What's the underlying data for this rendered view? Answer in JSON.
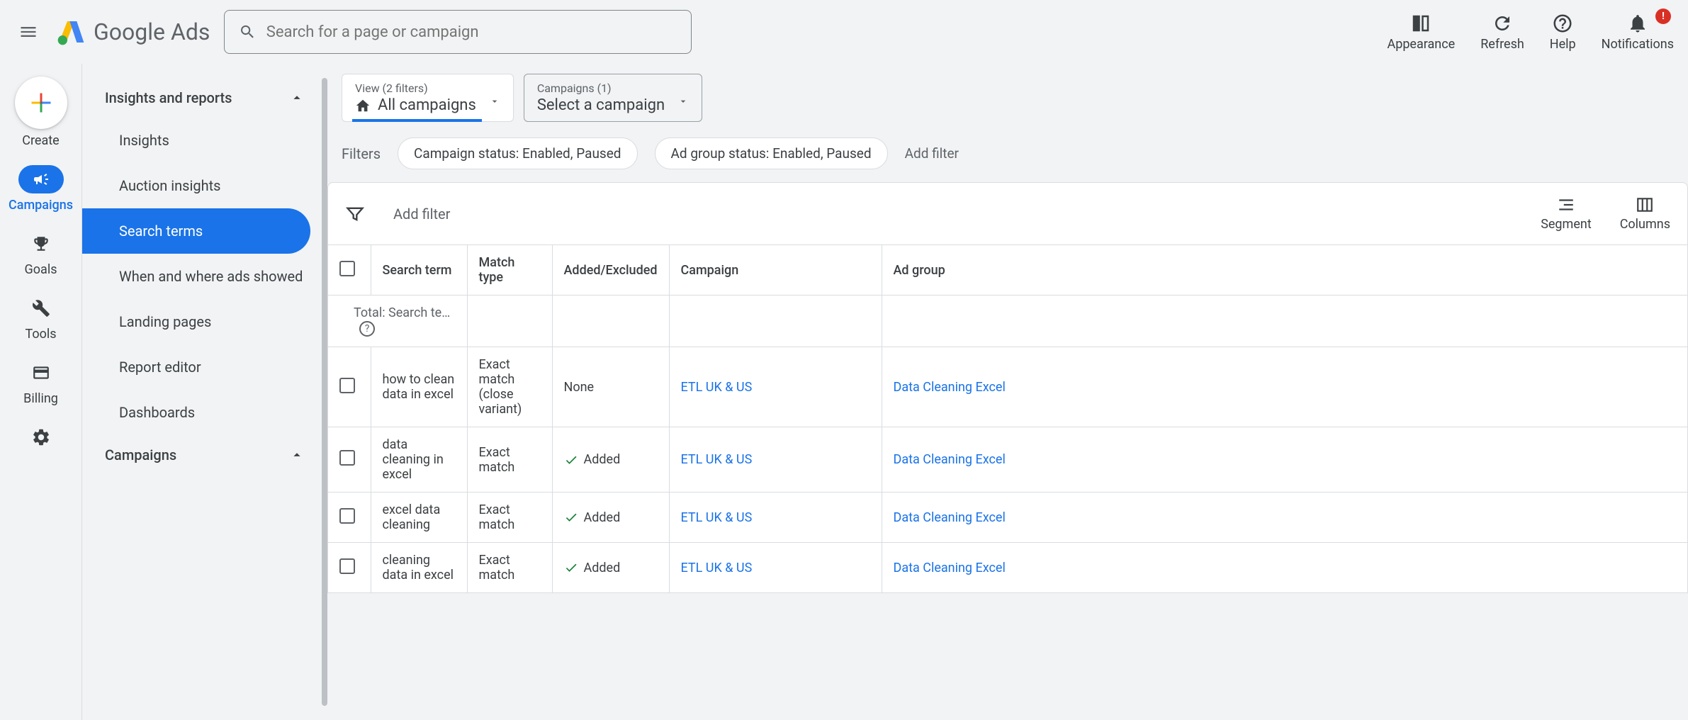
{
  "header": {
    "logo_text": "Google Ads",
    "search_placeholder": "Search for a page or campaign",
    "actions": {
      "appearance": "Appearance",
      "refresh": "Refresh",
      "help": "Help",
      "notifications": "Notifications",
      "notif_badge": "!"
    }
  },
  "rail": {
    "create": "Create",
    "campaigns": "Campaigns",
    "goals": "Goals",
    "tools": "Tools",
    "billing": "Billing"
  },
  "sidebar": {
    "section_insights": "Insights and reports",
    "items": [
      "Insights",
      "Auction insights",
      "Search terms",
      "When and where ads showed",
      "Landing pages",
      "Report editor",
      "Dashboards"
    ],
    "section_campaigns": "Campaigns"
  },
  "selectors": {
    "view_label": "View (2 filters)",
    "view_value": "All campaigns",
    "campaign_label": "Campaigns (1)",
    "campaign_value": "Select a campaign"
  },
  "filters": {
    "label": "Filters",
    "chip1": "Campaign status: Enabled, Paused",
    "chip2": "Ad group status: Enabled, Paused",
    "add": "Add filter"
  },
  "table_toolbar": {
    "add_filter": "Add filter",
    "segment": "Segment",
    "columns": "Columns"
  },
  "table": {
    "headers": {
      "search_term": "Search term",
      "match_type": "Match type",
      "added_excluded": "Added/Excluded",
      "campaign": "Campaign",
      "ad_group": "Ad group"
    },
    "total_label": "Total: Search te…",
    "rows": [
      {
        "term": "how to clean data in excel",
        "match": "Exact match (close variant)",
        "added": "None",
        "added_check": false,
        "campaign": "ETL UK & US",
        "ad_group": "Data Cleaning Excel"
      },
      {
        "term": "data cleaning in excel",
        "match": "Exact match",
        "added": "Added",
        "added_check": true,
        "campaign": "ETL UK & US",
        "ad_group": "Data Cleaning Excel"
      },
      {
        "term": "excel data cleaning",
        "match": "Exact match",
        "added": "Added",
        "added_check": true,
        "campaign": "ETL UK & US",
        "ad_group": "Data Cleaning Excel"
      },
      {
        "term": "cleaning data in excel",
        "match": "Exact match",
        "added": "Added",
        "added_check": true,
        "campaign": "ETL UK & US",
        "ad_group": "Data Cleaning Excel"
      }
    ]
  }
}
